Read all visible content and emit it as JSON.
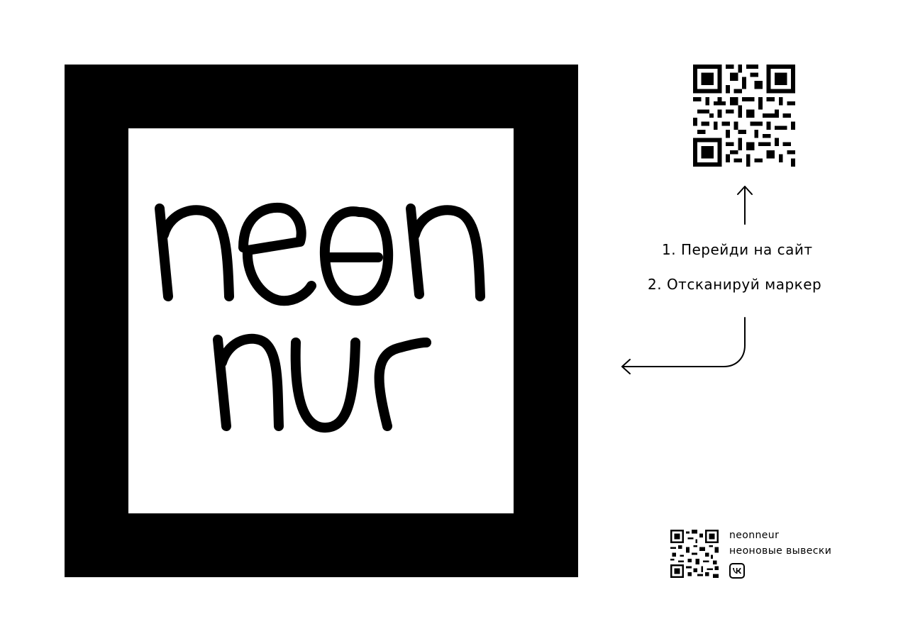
{
  "marker": {
    "logo_line_1": "neon",
    "logo_line_2": "nur"
  },
  "instructions": {
    "step_1": "1. Перейди на сайт",
    "step_2": "2. Отсканируй маркер"
  },
  "brand": {
    "name": "neonneur",
    "tagline": "неоновые вывески",
    "social_icon": "vk-icon"
  },
  "icons": {
    "qr_large": "qr-code-icon",
    "qr_small": "qr-code-icon",
    "arrow_up": "arrow-up-icon",
    "arrow_left": "arrow-left-icon"
  }
}
